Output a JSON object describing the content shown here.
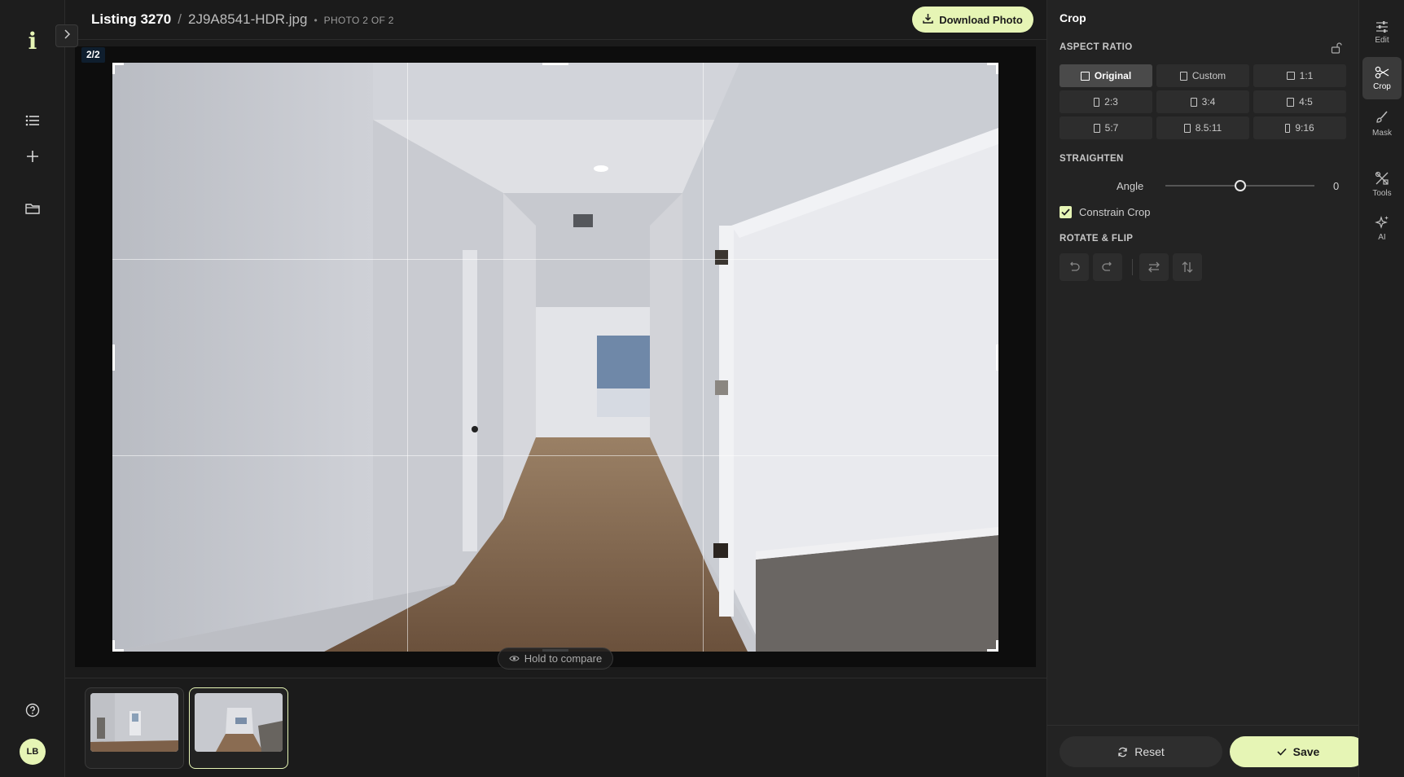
{
  "header": {
    "listing": "Listing 3270",
    "separator": "/",
    "filename": "2J9A8541-HDR.jpg",
    "dot": "•",
    "photo_count": "PHOTO 2 OF 2",
    "download_label": "Download Photo"
  },
  "canvas": {
    "badge": "2/2",
    "compare_label": "Hold to compare"
  },
  "left_rail": {
    "logo": "i",
    "avatar_initials": "LB",
    "icons": [
      "list-icon",
      "plus-icon",
      "folder-icon",
      "help-icon"
    ]
  },
  "panel": {
    "title": "Crop",
    "aspect_ratio_label": "ASPECT RATIO",
    "ratios": [
      {
        "label": "Original",
        "active": true
      },
      {
        "label": "Custom",
        "active": false
      },
      {
        "label": "1:1",
        "active": false
      },
      {
        "label": "2:3",
        "active": false
      },
      {
        "label": "3:4",
        "active": false
      },
      {
        "label": "4:5",
        "active": false
      },
      {
        "label": "5:7",
        "active": false
      },
      {
        "label": "8.5:11",
        "active": false
      },
      {
        "label": "9:16",
        "active": false
      }
    ],
    "straighten_label": "STRAIGHTEN",
    "angle_label": "Angle",
    "angle_value": "0",
    "angle_slider_position": 0.5,
    "constrain_label": "Constrain Crop",
    "constrain_checked": true,
    "rotate_flip_label": "ROTATE & FLIP",
    "reset_label": "Reset",
    "save_label": "Save"
  },
  "tools": [
    {
      "label": "Edit",
      "icon": "sliders-icon",
      "active": false
    },
    {
      "label": "Crop",
      "icon": "scissors-icon",
      "active": true
    },
    {
      "label": "Mask",
      "icon": "brush-icon",
      "active": false
    },
    {
      "label": "Tools",
      "icon": "tools-icon",
      "active": false
    },
    {
      "label": "AI",
      "icon": "sparkle-icon",
      "active": false
    }
  ],
  "colors": {
    "accent": "#e6f5b5",
    "background": "#1b1b1b",
    "panel": "#232323"
  }
}
